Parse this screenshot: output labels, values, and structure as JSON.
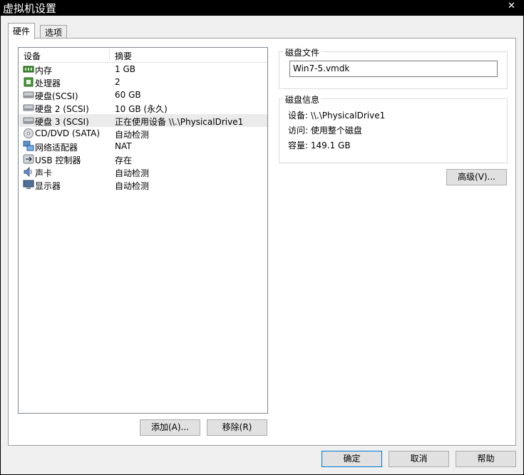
{
  "window": {
    "title": "虚拟机设置",
    "close_glyph": "✕"
  },
  "tabs": [
    {
      "label": "硬件",
      "active": true
    },
    {
      "label": "选项",
      "active": false
    }
  ],
  "device_list": {
    "columns": [
      "设备",
      "摘要"
    ],
    "rows": [
      {
        "name": "内存",
        "summary": "1 GB",
        "icon": "memory-icon"
      },
      {
        "name": "处理器",
        "summary": "2",
        "icon": "processor-icon"
      },
      {
        "name": "硬盘(SCSI)",
        "summary": "60 GB",
        "icon": "hard-disk-icon"
      },
      {
        "name": "硬盘 2 (SCSI)",
        "summary": "10 GB (永久)",
        "icon": "hard-disk-icon"
      },
      {
        "name": "硬盘 3 (SCSI)",
        "summary": "正在使用设备 \\\\.\\PhysicalDrive1",
        "icon": "hard-disk-icon",
        "selected": true
      },
      {
        "name": "CD/DVD (SATA)",
        "summary": "自动检测",
        "icon": "cd-dvd-icon"
      },
      {
        "name": "网络适配器",
        "summary": "NAT",
        "icon": "network-adapter-icon"
      },
      {
        "name": "USB 控制器",
        "summary": "存在",
        "icon": "usb-icon"
      },
      {
        "name": "声卡",
        "summary": "自动检测",
        "icon": "sound-card-icon"
      },
      {
        "name": "显示器",
        "summary": "自动检测",
        "icon": "display-icon"
      }
    ]
  },
  "list_buttons": {
    "add": "添加(A)...",
    "remove": "移除(R)"
  },
  "disk_file": {
    "legend": "磁盘文件",
    "value": "Win7-5.vmdk"
  },
  "disk_info": {
    "legend": "磁盘信息",
    "device": "设备:  \\\\.\\PhysicalDrive1",
    "access": "访问:  使用整个磁盘",
    "capacity": "容量: 149.1 GB"
  },
  "advanced_button": "高级(V)...",
  "footer": {
    "ok": "确定",
    "cancel": "取消",
    "help": "帮助"
  },
  "colors": {
    "accent": "#0078d7",
    "selection": "#ebebeb",
    "chrome": "#000000"
  }
}
